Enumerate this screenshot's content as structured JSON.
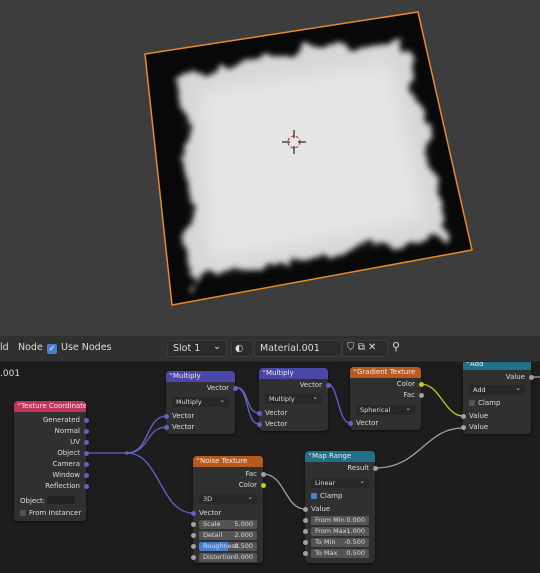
{
  "header": {
    "menu_partial": "ld",
    "node_menu": "Node",
    "use_nodes_label": "Use Nodes",
    "slot_value": "Slot 1",
    "material_name": "Material.001"
  },
  "editor": {
    "partial_label": ".001"
  },
  "nodes": {
    "texture_coordinate": {
      "title": "Texture Coordinate",
      "outputs": [
        "Generated",
        "Normal",
        "UV",
        "Object",
        "Camera",
        "Window",
        "Reflection"
      ],
      "object_label": "Object:",
      "from_instancer": "From Instancer",
      "color": "#c2345a"
    },
    "multiply1": {
      "title": "Multiply",
      "output": "Vector",
      "mode": "Multiply",
      "inputs": [
        "Vector",
        "Vector"
      ],
      "color": "#4b47a8"
    },
    "multiply2": {
      "title": "Multiply",
      "output": "Vector",
      "mode": "Multiply",
      "inputs": [
        "Vector",
        "Vector"
      ],
      "color": "#4b47a8"
    },
    "gradient": {
      "title": "Gradient Texture",
      "outputs": [
        "Color",
        "Fac"
      ],
      "mode": "Spherical",
      "input": "Vector",
      "color": "#b85a1f"
    },
    "add": {
      "title": "Add",
      "output": "Value",
      "mode": "Add",
      "clamp": "Clamp",
      "inputs": [
        "Value",
        "Value"
      ],
      "color": "#21708a"
    },
    "noise": {
      "title": "Noise Texture",
      "outputs": [
        "Fac",
        "Color"
      ],
      "dimension": "3D",
      "input_vector": "Vector",
      "fields": [
        {
          "label": "Scale",
          "value": "5.000"
        },
        {
          "label": "Detail",
          "value": "2.000"
        },
        {
          "label": "Roughness",
          "value": "0.500"
        },
        {
          "label": "Distortion",
          "value": "0.000"
        }
      ],
      "color": "#b85a1f"
    },
    "map_range": {
      "title": "Map Range",
      "output": "Result",
      "mode": "Linear",
      "clamp": "Clamp",
      "input_value": "Value",
      "fields": [
        {
          "label": "From Min",
          "value": "0.000"
        },
        {
          "label": "From Max",
          "value": "1.000"
        },
        {
          "label": "To Min",
          "value": "-0.500"
        },
        {
          "label": "To Max",
          "value": "0.500"
        }
      ],
      "color": "#21708a"
    }
  }
}
